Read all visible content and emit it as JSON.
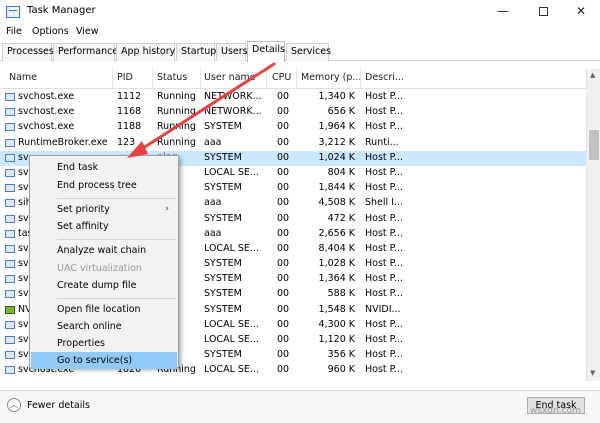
{
  "window": {
    "title": "Task Manager",
    "min_glyph": "—",
    "close_glyph": "✕"
  },
  "menubar": [
    "File",
    "Options",
    "View"
  ],
  "tabs": [
    "Processes",
    "Performance",
    "App history",
    "Startup",
    "Users",
    "Details",
    "Services"
  ],
  "active_tab": "Details",
  "columns": [
    "Name",
    "PID",
    "Status",
    "User name",
    "CPU",
    "Memory (p...",
    "Descri..."
  ],
  "rows": [
    {
      "name": "svchost.exe",
      "pid": "1112",
      "status": "Running",
      "user": "NETWORK...",
      "cpu": "00",
      "mem": "1,340 K",
      "desc": "Host P..."
    },
    {
      "name": "svchost.exe",
      "pid": "1168",
      "status": "Running",
      "user": "NETWORK...",
      "cpu": "00",
      "mem": "656 K",
      "desc": "Host P..."
    },
    {
      "name": "svchost.exe",
      "pid": "1188",
      "status": "Running",
      "user": "SYSTEM",
      "cpu": "00",
      "mem": "1,964 K",
      "desc": "Host P..."
    },
    {
      "name": "RuntimeBroker.exe",
      "pid": "123",
      "status": "Running",
      "user": "aaa",
      "cpu": "00",
      "mem": "3,212 K",
      "desc": "Runti..."
    },
    {
      "name": "sv",
      "pid": "",
      "status": "ning",
      "user": "SYSTEM",
      "cpu": "00",
      "mem": "1,024 K",
      "desc": "Host P...",
      "selected": true
    },
    {
      "name": "sv",
      "pid": "",
      "status": "ning",
      "user": "LOCAL SE...",
      "cpu": "00",
      "mem": "804 K",
      "desc": "Host P..."
    },
    {
      "name": "sv",
      "pid": "",
      "status": "ning",
      "user": "SYSTEM",
      "cpu": "00",
      "mem": "1,844 K",
      "desc": "Host P..."
    },
    {
      "name": "sih",
      "pid": "",
      "status": "ning",
      "user": "aaa",
      "cpu": "00",
      "mem": "4,508 K",
      "desc": "Shell I..."
    },
    {
      "name": "sv",
      "pid": "",
      "status": "ning",
      "user": "SYSTEM",
      "cpu": "00",
      "mem": "472 K",
      "desc": "Host P..."
    },
    {
      "name": "tas",
      "pid": "",
      "status": "ning",
      "user": "aaa",
      "cpu": "00",
      "mem": "2,656 K",
      "desc": "Host P..."
    },
    {
      "name": "sv",
      "pid": "",
      "status": "ning",
      "user": "LOCAL SE...",
      "cpu": "00",
      "mem": "8,404 K",
      "desc": "Host P..."
    },
    {
      "name": "sv",
      "pid": "",
      "status": "ning",
      "user": "SYSTEM",
      "cpu": "00",
      "mem": "1,028 K",
      "desc": "Host P..."
    },
    {
      "name": "sv",
      "pid": "",
      "status": "ning",
      "user": "SYSTEM",
      "cpu": "00",
      "mem": "1,364 K",
      "desc": "Host P..."
    },
    {
      "name": "sv",
      "pid": "",
      "status": "ning",
      "user": "SYSTEM",
      "cpu": "00",
      "mem": "588 K",
      "desc": "Host P..."
    },
    {
      "name": "NV",
      "pid": "",
      "status": "ning",
      "user": "SYSTEM",
      "cpu": "00",
      "mem": "1,548 K",
      "desc": "NVIDI...",
      "green": true
    },
    {
      "name": "sv",
      "pid": "",
      "status": "ning",
      "user": "LOCAL SE...",
      "cpu": "00",
      "mem": "4,300 K",
      "desc": "Host P..."
    },
    {
      "name": "sv",
      "pid": "",
      "status": "ning",
      "user": "LOCAL SE...",
      "cpu": "00",
      "mem": "1,120 K",
      "desc": "Host P..."
    },
    {
      "name": "sv",
      "pid": "",
      "status": "ning",
      "user": "SYSTEM",
      "cpu": "00",
      "mem": "356 K",
      "desc": "Host P..."
    },
    {
      "name": "svchost.exe",
      "pid": "1820",
      "status": "Running",
      "user": "LOCAL SE...",
      "cpu": "00",
      "mem": "960 K",
      "desc": "Host P..."
    }
  ],
  "context_menu": {
    "end_task": "End task",
    "end_process_tree": "End process tree",
    "set_priority": "Set priority",
    "set_affinity": "Set affinity",
    "analyze_wait_chain": "Analyze wait chain",
    "uac_virtualization": "UAC virtualization",
    "create_dump_file": "Create dump file",
    "open_file_location": "Open file location",
    "search_online": "Search online",
    "properties": "Properties",
    "go_to_services": "Go to service(s)",
    "submenu_arrow": "›"
  },
  "footer": {
    "fewer_details": "Fewer details",
    "end_task": "End task"
  },
  "watermark": "wsxdn.com",
  "colors": {
    "selected_row": "#cce8ff",
    "menu_highlight": "#91c9f7",
    "annotation_arrow": "#e8423f"
  }
}
